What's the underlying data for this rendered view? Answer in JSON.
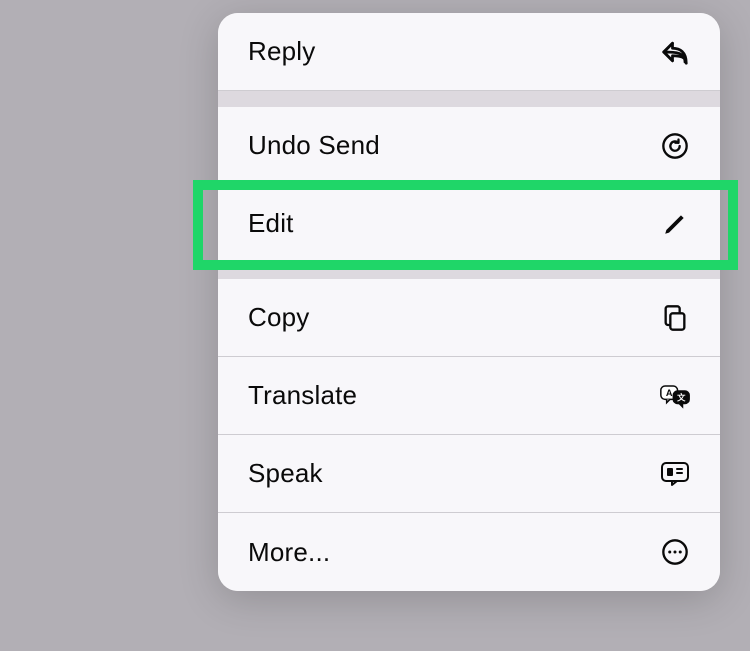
{
  "menu": {
    "reply": {
      "label": "Reply"
    },
    "undo_send": {
      "label": "Undo Send"
    },
    "edit": {
      "label": "Edit"
    },
    "copy": {
      "label": "Copy"
    },
    "translate": {
      "label": "Translate"
    },
    "speak": {
      "label": "Speak"
    },
    "more": {
      "label": "More..."
    }
  },
  "highlight": {
    "target": "edit",
    "color": "#1fd668"
  }
}
